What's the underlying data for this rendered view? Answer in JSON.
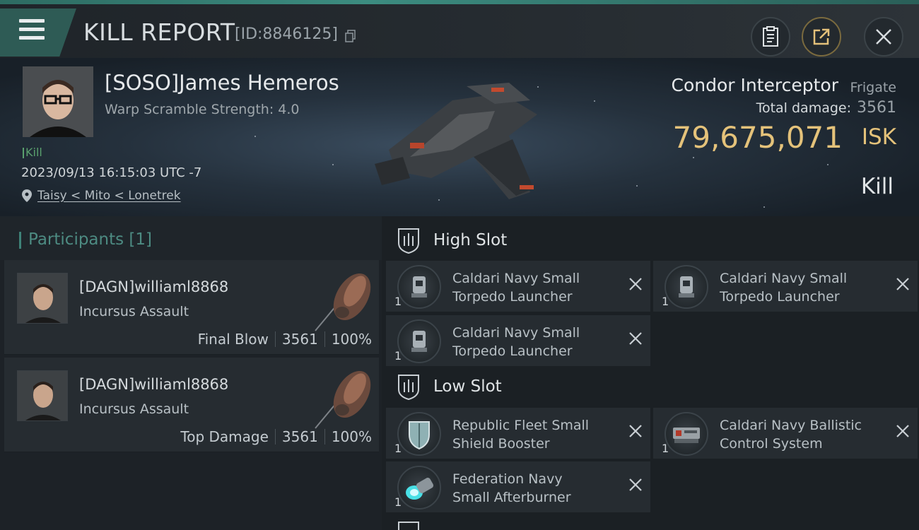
{
  "header": {
    "title": "KILL REPORT",
    "report_id": "[ID:8846125]"
  },
  "victim": {
    "name": "[SOSO]James Hemeros",
    "warp_scramble": "Warp Scramble Strength: 4.0",
    "tag": "Kill",
    "datetime": "2023/09/13 16:15:03 UTC -7",
    "location": "Taisy < Mito < Lonetrek",
    "ship_name": "Condor Interceptor",
    "ship_class": "Frigate",
    "total_damage_label": "Total damage:",
    "total_damage": "3561",
    "isk_value": "79,675,071",
    "isk_unit": "ISK",
    "result": "Kill"
  },
  "participants": {
    "title": "Participants [1]",
    "items": [
      {
        "name": "[DAGN]williaml8868",
        "ship": "Incursus Assault",
        "role": "Final Blow",
        "damage": "3561",
        "percent": "100%"
      },
      {
        "name": "[DAGN]williaml8868",
        "ship": "Incursus Assault",
        "role": "Top Damage",
        "damage": "3561",
        "percent": "100%"
      }
    ]
  },
  "slots": {
    "high": {
      "label": "High Slot",
      "items": [
        {
          "line1": "Caldari Navy Small",
          "line2": "Torpedo Launcher",
          "qty": "1"
        },
        {
          "line1": "Caldari Navy Small",
          "line2": "Torpedo Launcher",
          "qty": "1"
        },
        {
          "line1": "Caldari Navy Small",
          "line2": "Torpedo Launcher",
          "qty": "1"
        }
      ]
    },
    "low": {
      "label": "Low Slot",
      "items": [
        {
          "line1": "Republic Fleet Small",
          "line2": "Shield Booster",
          "qty": "1"
        },
        {
          "line1": "Caldari Navy Ballistic",
          "line2": "Control System",
          "qty": "1"
        },
        {
          "line1": "Federation Navy",
          "line2": "Small Afterburner",
          "qty": "1"
        }
      ]
    }
  },
  "icons": {
    "menu": "menu-icon",
    "copy": "copy-icon",
    "clipboard": "clipboard-icon",
    "share": "share-icon",
    "close": "close-icon",
    "location": "location-pin-icon",
    "slot": "slot-icon"
  },
  "colors": {
    "accent_teal": "#2e5b55",
    "isk_gold": "#e4c27a",
    "kill_green": "#5aa06e"
  }
}
